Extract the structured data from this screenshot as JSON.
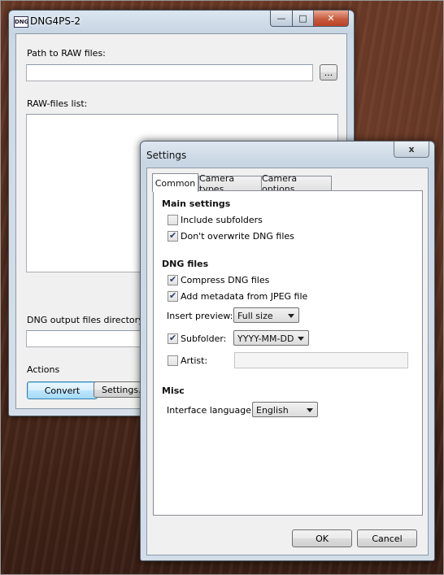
{
  "main_window": {
    "title": "DNG4PS-2",
    "icon_text": "DNG",
    "path_label": "Path to RAW files:",
    "path_value": "",
    "browse_label": "...",
    "raw_list_label": "RAW-files list:",
    "output_dir_label": "DNG output files directory:",
    "output_dir_value": "",
    "actions_label": "Actions",
    "convert_label": "Convert",
    "settings_label": "Settings..."
  },
  "settings_dialog": {
    "title": "Settings",
    "close_glyph": "x",
    "tabs": [
      {
        "label": "Common",
        "active": true
      },
      {
        "label": "Camera types",
        "active": false
      },
      {
        "label": "Camera options",
        "active": false
      }
    ],
    "main_settings": {
      "heading": "Main settings",
      "include_subfolders": {
        "label": "Include subfolders",
        "checked": false
      },
      "dont_overwrite": {
        "label": "Don't overwrite DNG files",
        "checked": true
      }
    },
    "dng_files": {
      "heading": "DNG files",
      "compress": {
        "label": "Compress DNG files",
        "checked": true
      },
      "add_metadata": {
        "label": "Add metadata from JPEG file",
        "checked": true
      },
      "insert_preview_label": "Insert preview:",
      "insert_preview_value": "Full size",
      "subfolder": {
        "label": "Subfolder:",
        "checked": true,
        "value": "YYYY-MM-DD"
      },
      "artist": {
        "label": "Artist:",
        "checked": false,
        "value": ""
      }
    },
    "misc": {
      "heading": "Misc",
      "language_label": "Interface language:",
      "language_value": "English"
    },
    "ok_label": "OK",
    "cancel_label": "Cancel"
  },
  "window_buttons": {
    "minimize": "—",
    "maximize": "□",
    "close": "✕"
  }
}
